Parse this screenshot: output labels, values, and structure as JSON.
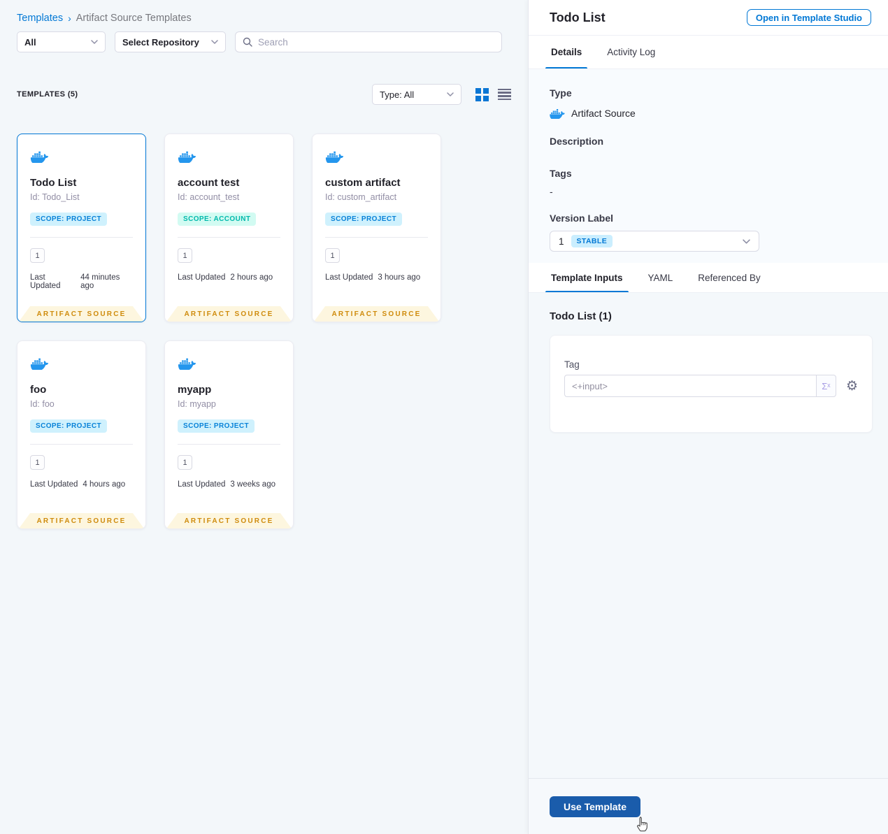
{
  "breadcrumb": {
    "root": "Templates",
    "separator": "›",
    "current": "Artifact Source Templates"
  },
  "filters": {
    "scope": "All",
    "repository": "Select Repository",
    "search_placeholder": "Search"
  },
  "list_header": {
    "count_label": "TEMPLATES (5)",
    "type_filter": "Type: All"
  },
  "cards": [
    {
      "title": "Todo List",
      "id": "Id: Todo_List",
      "scope": "SCOPE: PROJECT",
      "version_count": "1",
      "updated_label": "Last Updated",
      "updated": "44 minutes ago",
      "ribbon": "ARTIFACT SOURCE"
    },
    {
      "title": "account test",
      "id": "Id: account_test",
      "scope": "SCOPE: ACCOUNT",
      "version_count": "1",
      "updated_label": "Last Updated",
      "updated": "2 hours ago",
      "ribbon": "ARTIFACT SOURCE"
    },
    {
      "title": "custom artifact",
      "id": "Id: custom_artifact",
      "scope": "SCOPE: PROJECT",
      "version_count": "1",
      "updated_label": "Last Updated",
      "updated": "3 hours ago",
      "ribbon": "ARTIFACT SOURCE"
    },
    {
      "title": "foo",
      "id": "Id: foo",
      "scope": "SCOPE: PROJECT",
      "version_count": "1",
      "updated_label": "Last Updated",
      "updated": "4 hours ago",
      "ribbon": "ARTIFACT SOURCE"
    },
    {
      "title": "myapp",
      "id": "Id: myapp",
      "scope": "SCOPE: PROJECT",
      "version_count": "1",
      "updated_label": "Last Updated",
      "updated": "3 weeks ago",
      "ribbon": "ARTIFACT SOURCE"
    }
  ],
  "panel": {
    "title": "Todo List",
    "open_studio": "Open in Template Studio",
    "tabs": {
      "details": "Details",
      "activity": "Activity Log"
    },
    "details": {
      "type_label": "Type",
      "type_value": "Artifact Source",
      "description_label": "Description",
      "tags_label": "Tags",
      "tags_value": "-",
      "version_label": "Version Label",
      "version_value": "1",
      "version_badge": "STABLE"
    },
    "input_tabs": {
      "inputs": "Template Inputs",
      "yaml": "YAML",
      "referenced": "Referenced By"
    },
    "inputs": {
      "section_title": "Todo List (1)",
      "tag_label": "Tag",
      "tag_value": "<+input>"
    },
    "footer": {
      "use_template": "Use Template"
    }
  },
  "icons": {
    "gear": "⚙",
    "expression": "Σˣ"
  },
  "colors": {
    "accent": "#0278d5",
    "docker": "#2496ed",
    "ribbon_text": "#cf8b0c",
    "primary_button": "#1a5cab",
    "scope_project_bg": "#cff1fd",
    "scope_account_bg": "#d2fbf2",
    "stable_badge_bg": "#cbeefe"
  }
}
